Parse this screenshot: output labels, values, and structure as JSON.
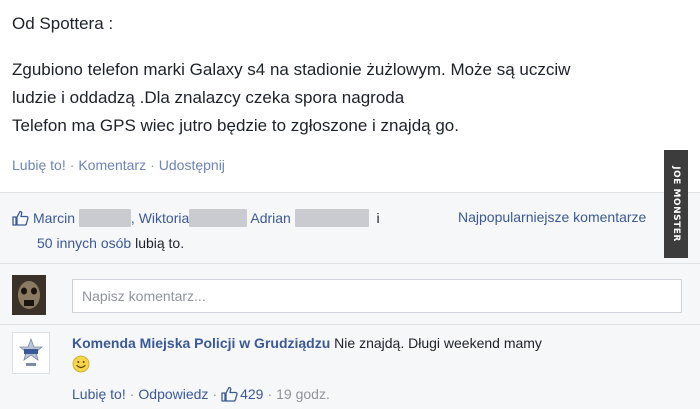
{
  "post": {
    "header": "Od Spottera :",
    "body_lines": [
      "Zgubiono telefon marki Galaxy s4 na stadionie żużlowym. Może są uczciw",
      "ludzie i oddadzą .Dla znalazcy czeka spora nagroda",
      "Telefon ma GPS wiec jutro będzie to zgłoszone i znajdą go."
    ],
    "actions": {
      "like": "Lubię to!",
      "comment": "Komentarz",
      "share": "Udostępnij"
    }
  },
  "likes": {
    "icon": "thumbs-up-icon",
    "name1": "Marcin",
    "name2": "Wiktoria",
    "name3": "Adrian",
    "conj": "i",
    "others": "50 innych osób",
    "suffix": "lubią to.",
    "sort_label": "Najpopularniejsze komentarze"
  },
  "comment_box": {
    "placeholder": "Napisz komentarz..."
  },
  "comment": {
    "author": "Komenda Miejska Policji w Grudziądzu",
    "text": "Nie znajdą. Długi weekend mamy",
    "emoji": "smiley-emoji",
    "like": "Lubię to!",
    "reply": "Odpowiedz",
    "like_count": "429",
    "time": "19 godz."
  },
  "watermark": "JOE MONSTER",
  "colors": {
    "link": "#3b5998",
    "feedback_bg": "#f6f7f9",
    "text": "#1d2129"
  }
}
